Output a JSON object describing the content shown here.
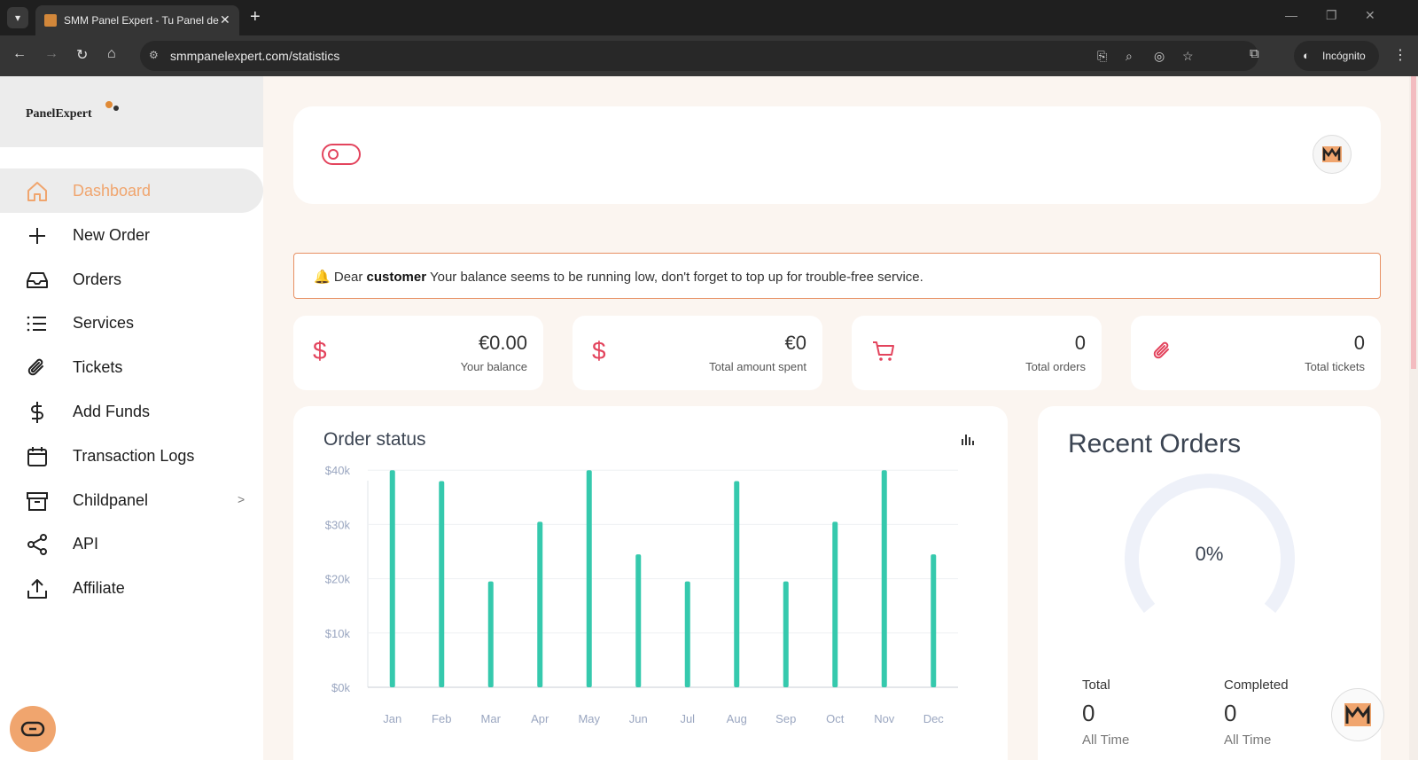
{
  "browser": {
    "tab_title": "SMM Panel Expert - Tu Panel de",
    "url": "smmpanelexpert.com/statistics",
    "incognito_label": "Incógnito"
  },
  "sidebar": {
    "logo_text": "PanelExpert",
    "items": [
      {
        "label": "Dashboard",
        "icon": "home-icon",
        "active": true
      },
      {
        "label": "New Order",
        "icon": "plus-icon"
      },
      {
        "label": "Orders",
        "icon": "inbox-icon"
      },
      {
        "label": "Services",
        "icon": "list-icon"
      },
      {
        "label": "Tickets",
        "icon": "paperclip-icon"
      },
      {
        "label": "Add Funds",
        "icon": "dollar-icon"
      },
      {
        "label": "Transaction Logs",
        "icon": "calendar-icon"
      },
      {
        "label": "Childpanel",
        "icon": "archive-icon",
        "has_submenu": true
      },
      {
        "label": "API",
        "icon": "share-icon"
      },
      {
        "label": "Affiliate",
        "icon": "upload-icon"
      }
    ]
  },
  "alert": {
    "prefix": "Dear",
    "name": "customer",
    "message": "Your balance seems to be running low, don't forget to top up for trouble-free service."
  },
  "stats": [
    {
      "value": "€0.00",
      "label": "Your balance",
      "icon": "dollar-icon"
    },
    {
      "value": "€0",
      "label": "Total amount spent",
      "icon": "dollar-icon"
    },
    {
      "value": "0",
      "label": "Total orders",
      "icon": "cart-icon"
    },
    {
      "value": "0",
      "label": "Total tickets",
      "icon": "paperclip-icon"
    }
  ],
  "order_status": {
    "title": "Order status"
  },
  "chart_data": {
    "type": "bar",
    "title": "Order status",
    "categories": [
      "Jan",
      "Feb",
      "Mar",
      "Apr",
      "May",
      "Jun",
      "Jul",
      "Aug",
      "Sep",
      "Oct",
      "Nov",
      "Dec"
    ],
    "values": [
      40000,
      38000,
      19500,
      30500,
      40000,
      24500,
      19500,
      38000,
      19500,
      30500,
      40000,
      24500
    ],
    "yticks": [
      "$0k",
      "$10k",
      "$20k",
      "$30k",
      "$40k"
    ],
    "ylim": [
      0,
      42000
    ],
    "grid": true,
    "colors": {
      "bar": "#35c9ad"
    }
  },
  "recent_orders": {
    "title": "Recent Orders",
    "percent_label": "0%",
    "percent": 0,
    "total_label": "Total",
    "total_value": "0",
    "total_sub": "All Time",
    "completed_label": "Completed",
    "completed_value": "0",
    "completed_sub": "All Time"
  },
  "colors": {
    "accent": "#f0a56e",
    "danger": "#e3445d",
    "bar": "#35c9ad"
  }
}
